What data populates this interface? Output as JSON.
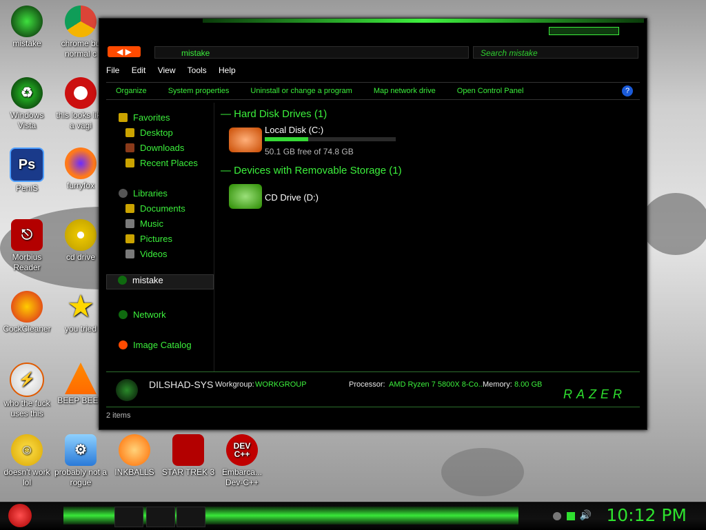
{
  "desktop_icons": [
    {
      "label": "mistake",
      "color": "#0f2a0f"
    },
    {
      "label": "chrome bu normal c",
      "color": "#2b63d9"
    },
    {
      "label": "Windows Vista",
      "color": "#0f2a0f"
    },
    {
      "label": "this looks like a vagi",
      "color": "#cc1010"
    },
    {
      "label": "PeniS",
      "color": "#1a6ad8"
    },
    {
      "label": "furryfox",
      "color": "#ff7a1a"
    },
    {
      "label": "Morbius Reader",
      "color": "#b30000"
    },
    {
      "label": "cd drive",
      "color": "#d2b100"
    },
    {
      "label": "CockCleaner",
      "color": "#1b5ed6"
    },
    {
      "label": "you tried",
      "color": "#ffd700"
    },
    {
      "label": "who the fuck uses this",
      "color": "#e05a00"
    },
    {
      "label": "BEEP BEEP",
      "color": "#ff7a00"
    },
    {
      "label": "doesn't work lol",
      "color": "#6a0fb3"
    },
    {
      "label": "probably not a rogue",
      "color": "#2a7ad8"
    },
    {
      "label": "INKBALLS",
      "color": "#ff6a00"
    },
    {
      "label": "STAR TREK 3",
      "color": "#b30000"
    },
    {
      "label": "Embarca... Dev-C++",
      "color": "#c00000"
    }
  ],
  "window": {
    "address": "mistake",
    "search_placeholder": "Search mistake",
    "menu": [
      "File",
      "Edit",
      "View",
      "Tools",
      "Help"
    ],
    "commands": [
      "Organize",
      "System properties",
      "Uninstall or change a program",
      "Map network drive",
      "Open Control Panel"
    ],
    "nav": {
      "favorites": "Favorites",
      "favorites_items": [
        "Desktop",
        "Downloads",
        "Recent Places"
      ],
      "libraries": "Libraries",
      "libraries_items": [
        "Documents",
        "Music",
        "Pictures",
        "Videos"
      ],
      "computer": "mistake",
      "network": "Network",
      "image_catalog": "Image Catalog"
    },
    "groups": {
      "hdd_header": "Hard Disk Drives (1)",
      "local_disk": "Local Disk (C:)",
      "local_disk_free": "50.1 GB free of 74.8 GB",
      "used_fraction": 0.33,
      "removable_header": "Devices with Removable Storage (1)",
      "cd_drive": "CD Drive (D:)"
    },
    "details": {
      "computer_name": "DILSHAD-SYS",
      "workgroup_label": "Workgroup:",
      "workgroup_value": "WORKGROUP",
      "processor_label": "Processor:",
      "processor_value": "AMD Ryzen 7 5800X 8-Co...",
      "memory_label": "Memory:",
      "memory_value": "8.00 GB",
      "brand": "RAZER"
    },
    "status": "2 items"
  },
  "taskbar": {
    "clock": "10:12 PM"
  },
  "colors": {
    "accent": "#3cf03c",
    "bg": "#000000"
  }
}
